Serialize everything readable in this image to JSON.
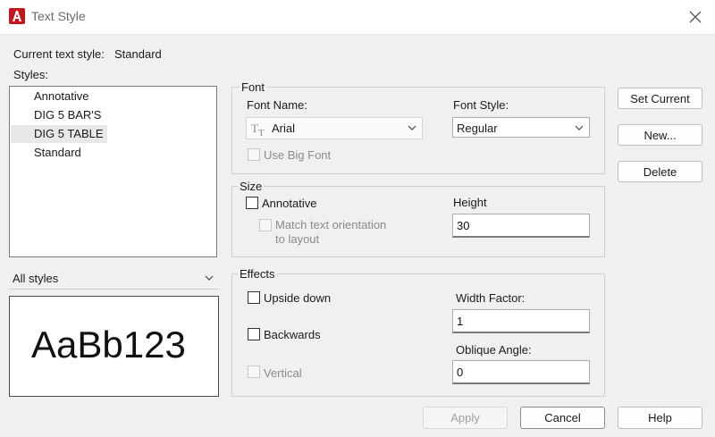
{
  "window": {
    "title": "Text Style",
    "app_icon": "autocad-logo-icon",
    "close_icon": "close-icon",
    "accent": "#c4161c"
  },
  "current_style": {
    "label": "Current text style:",
    "value": "Standard"
  },
  "styles": {
    "label": "Styles:",
    "items": [
      "Annotative",
      "DIG 5 BAR'S",
      "DIG 5 TABLE",
      "Standard"
    ],
    "selected_index": 2
  },
  "filter": {
    "value": "All styles"
  },
  "preview": {
    "text": "AaBb123"
  },
  "font": {
    "group_label": "Font",
    "name_label": "Font Name:",
    "name_value": "Arial",
    "name_icon": "truetype-font-icon",
    "style_label": "Font Style:",
    "style_value": "Regular",
    "big_font_label": "Use Big Font"
  },
  "size": {
    "group_label": "Size",
    "annotative_label": "Annotative",
    "match_label_line1": "Match text orientation",
    "match_label_line2": "to layout",
    "height_label": "Height",
    "height_value": "30"
  },
  "effects": {
    "group_label": "Effects",
    "upside_down_label": "Upside down",
    "backwards_label": "Backwards",
    "vertical_label": "Vertical",
    "width_factor_label": "Width Factor:",
    "width_factor_value": "1",
    "oblique_label": "Oblique Angle:",
    "oblique_value": "0"
  },
  "buttons": {
    "set_current": "Set Current",
    "new": "New...",
    "delete": "Delete",
    "apply": "Apply",
    "cancel": "Cancel",
    "help": "Help"
  }
}
